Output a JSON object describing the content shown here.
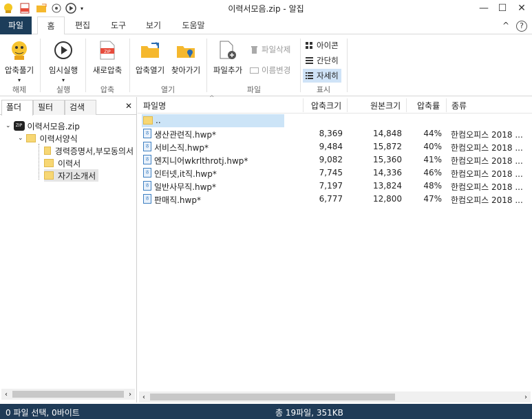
{
  "title": "이력서모음.zip - 알집",
  "quick_access": [
    "app-icon",
    "zip-icon",
    "folder-open-icon",
    "settings-icon",
    "play-icon",
    "dropdown-icon"
  ],
  "window_controls": {
    "minimize": "—",
    "maximize": "☐",
    "close": "✕"
  },
  "tabs": [
    "파일",
    "홈",
    "편집",
    "도구",
    "보기",
    "도움말"
  ],
  "ribbon_right": {
    "collapse": "^",
    "help": "?"
  },
  "ribbon": {
    "extract": {
      "label": "압축풀기",
      "group": "해제"
    },
    "temp_run": {
      "label": "임시실행",
      "group": "실행"
    },
    "new_zip": {
      "label": "새로압축",
      "group": "압축"
    },
    "open_zip": {
      "label": "압축열기"
    },
    "find": {
      "label": "찾아가기"
    },
    "open_group": "열기",
    "add_file": {
      "label": "파일추가"
    },
    "delete_file": "파일삭제",
    "rename": "이름변경",
    "file_group": "파일",
    "view_icon": "아이콘",
    "view_simple": "간단히",
    "view_detail": "자세히",
    "view_group": "표시"
  },
  "left_tabs": [
    "폴더",
    "필터",
    "검색"
  ],
  "left_close": "✕",
  "tree": [
    {
      "label": "이력서모음.zip",
      "level": 0
    },
    {
      "label": "이력서양식",
      "level": 1
    },
    {
      "label": "경력증명서,부모동의서",
      "level": 2
    },
    {
      "label": "이력서",
      "level": 2
    },
    {
      "label": "자기소개서",
      "level": 2
    }
  ],
  "columns": [
    "파일명",
    "압축크기",
    "원본크기",
    "압축률",
    "종류"
  ],
  "files": [
    {
      "name": "..",
      "comp": "",
      "orig": "",
      "ratio": "",
      "type": ""
    },
    {
      "name": "생산관련직.hwp*",
      "comp": "8,369",
      "orig": "14,848",
      "ratio": "44%",
      "type": "한컴오피스 2018 ..."
    },
    {
      "name": "서비스직.hwp*",
      "comp": "9,484",
      "orig": "15,872",
      "ratio": "40%",
      "type": "한컴오피스 2018 ..."
    },
    {
      "name": "엔지니어wkrlthrotj.hwp*",
      "comp": "9,082",
      "orig": "15,360",
      "ratio": "41%",
      "type": "한컴오피스 2018 ..."
    },
    {
      "name": "인터넷,it직.hwp*",
      "comp": "7,745",
      "orig": "14,336",
      "ratio": "46%",
      "type": "한컴오피스 2018 ..."
    },
    {
      "name": "일반사무직.hwp*",
      "comp": "7,197",
      "orig": "13,824",
      "ratio": "48%",
      "type": "한컴오피스 2018 ..."
    },
    {
      "name": "판매직.hwp*",
      "comp": "6,777",
      "orig": "12,800",
      "ratio": "47%",
      "type": "한컴오피스 2018 ..."
    }
  ],
  "status": {
    "left": "0 파일 선택, 0바이트",
    "center": "총 19파일, 351KB"
  }
}
